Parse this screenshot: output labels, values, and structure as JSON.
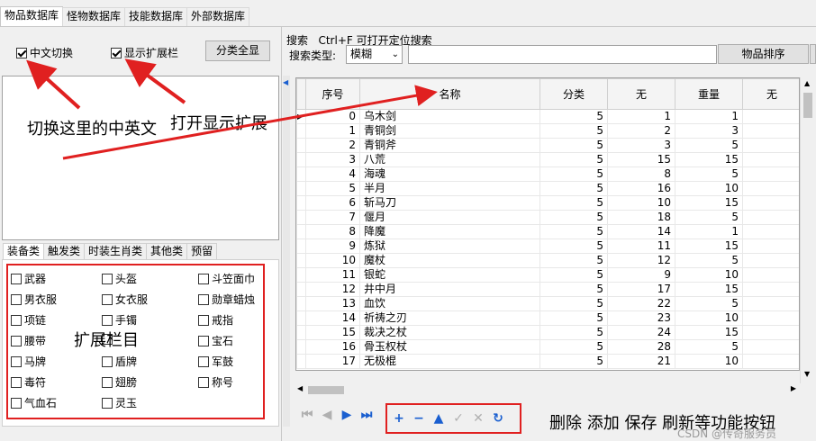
{
  "top_tabs": [
    "物品数据库",
    "怪物数据库",
    "技能数据库",
    "外部数据库"
  ],
  "options": {
    "chinese_toggle": "中文切换",
    "show_extension": "显示扩展栏",
    "show_all_button": "分类全显"
  },
  "search": {
    "label": "搜索",
    "hint": "Ctrl+F 可打开定位搜索",
    "type_label": "搜索类型:",
    "type_value": "模糊",
    "sort_button": "物品排序"
  },
  "category_tabs": [
    "装备类",
    "触发类",
    "时装生肖类",
    "其他类",
    "预留"
  ],
  "extension_items": [
    [
      "武器",
      "头盔",
      "斗笠面巾"
    ],
    [
      "男衣服",
      "女衣服",
      "勋章蜡烛"
    ],
    [
      "项链",
      "手镯",
      "戒指"
    ],
    [
      "腰带",
      "",
      "宝石"
    ],
    [
      "马牌",
      "盾牌",
      "军鼓"
    ],
    [
      "毒符",
      "翅膀",
      "称号"
    ],
    [
      "气血石",
      "灵玉",
      ""
    ]
  ],
  "table": {
    "columns": [
      "序号",
      "名称",
      "分类",
      "无",
      "重量",
      "无"
    ],
    "rows": [
      [
        "0",
        "乌木剑",
        "5",
        "1",
        "1"
      ],
      [
        "1",
        "青铜剑",
        "5",
        "2",
        "3"
      ],
      [
        "2",
        "青铜斧",
        "5",
        "3",
        "5"
      ],
      [
        "3",
        "八荒",
        "5",
        "15",
        "15"
      ],
      [
        "4",
        "海魂",
        "5",
        "8",
        "5"
      ],
      [
        "5",
        "半月",
        "5",
        "16",
        "10"
      ],
      [
        "6",
        "斩马刀",
        "5",
        "10",
        "15"
      ],
      [
        "7",
        "偃月",
        "5",
        "18",
        "5"
      ],
      [
        "8",
        "降魔",
        "5",
        "14",
        "1"
      ],
      [
        "9",
        "炼狱",
        "5",
        "11",
        "15"
      ],
      [
        "10",
        "魔杖",
        "5",
        "12",
        "5"
      ],
      [
        "11",
        "银蛇",
        "5",
        "9",
        "10"
      ],
      [
        "12",
        "井中月",
        "5",
        "17",
        "15"
      ],
      [
        "13",
        "血饮",
        "5",
        "22",
        "5"
      ],
      [
        "14",
        "祈祷之刃",
        "5",
        "23",
        "10"
      ],
      [
        "15",
        "裁决之杖",
        "5",
        "24",
        "15"
      ],
      [
        "16",
        "骨玉权杖",
        "5",
        "28",
        "5"
      ],
      [
        "17",
        "无极棍",
        "5",
        "21",
        "10"
      ]
    ]
  },
  "annotations": {
    "toggle_note": "切换这里的中英文",
    "extension_note": "打开显示扩展",
    "ext_panel_note": "扩展栏目",
    "buttons_note": "删除 添加 保存 刷新等功能按钮"
  },
  "watermark": "CSDN @传奇服务员",
  "colors": {
    "annotation_red": "#e02020",
    "nav_blue": "#1a5fd0"
  }
}
